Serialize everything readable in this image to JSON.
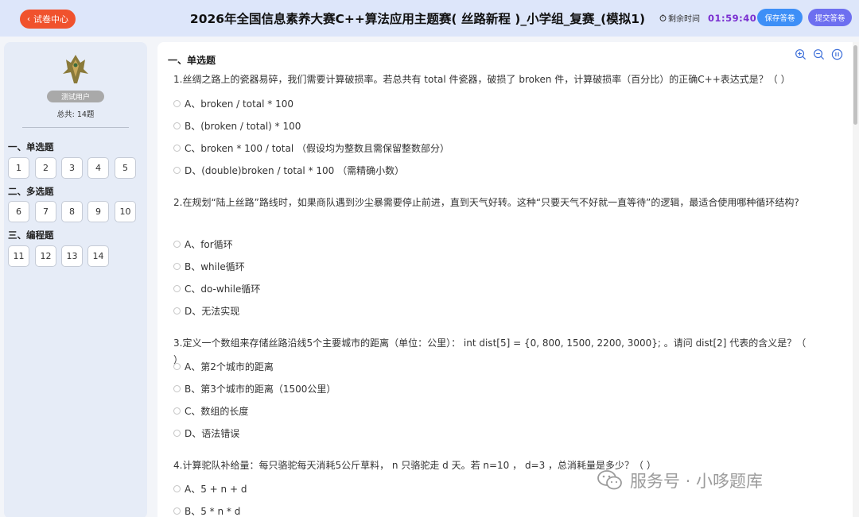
{
  "header": {
    "back_label": "试卷中心",
    "title": "2026年全国信息素养大赛C++算法应用主题赛( 丝路新程 )_小学组_复赛_(模拟1)",
    "timer_label": "剩余时间",
    "timer_value": "01:59:40",
    "save_label": "保存答卷",
    "submit_label": "提交答卷"
  },
  "sidebar": {
    "user_name": "测试用户",
    "total_label": "总共: 14题",
    "sections": [
      {
        "title": "一、单选题",
        "numbers": [
          "1",
          "2",
          "3",
          "4",
          "5"
        ]
      },
      {
        "title": "二、多选题",
        "numbers": [
          "6",
          "7",
          "8",
          "9",
          "10"
        ]
      },
      {
        "title": "三、编程题",
        "numbers": [
          "11",
          "12",
          "13",
          "14"
        ]
      }
    ]
  },
  "main": {
    "section_title": "一、单选题",
    "questions": [
      {
        "text": "1.丝绸之路上的瓷器易碎，我们需要计算破损率。若总共有  total  件瓷器，破损了  broken  件，计算破损率（百分比）的正确C++表达式是？（ ）",
        "options": [
          "A、broken / total * 100",
          "B、(broken / total) * 100",
          "C、broken * 100 / total  （假设均为整数且需保留整数部分）",
          "D、(double)broken / total * 100  （需精确小数）"
        ]
      },
      {
        "text": "2.在规划“陆上丝路”路线时，如果商队遇到沙尘暴需要停止前进，直到天气好转。这种“只要天气不好就一直等待”的逻辑，最适合使用哪种循环结构?",
        "options": [
          "A、for循环",
          "B、while循环",
          "C、do-while循环",
          "D、无法实现"
        ]
      },
      {
        "text": "3.定义一个数组来存储丝路沿线5个主要城市的距离（单位：公里）：  int dist[5] = {0, 800, 1500, 2200, 3000};  。请问  dist[2]  代表的含义是？（ ）",
        "options": [
          "A、第2个城市的距离",
          "B、第3个城市的距离（1500公里）",
          "C、数组的长度",
          "D、语法错误"
        ]
      },
      {
        "text": "4.计算驼队补给量：每只骆驼每天消耗5公斤草料，  n  只骆驼走  d  天。若  n=10 ，  d=3 ，总消耗量是多少？（ ）",
        "options": [
          "A、5 + n + d",
          "B、5 * n * d"
        ]
      }
    ]
  },
  "watermark": "服务号 · 小哆题库",
  "colors": {
    "header_bg": "#dde6fa",
    "back_button": "#f0522d",
    "timer": "#7a2fd0",
    "save_button": "#3d8ff7",
    "submit_button": "#6d6ff0"
  }
}
